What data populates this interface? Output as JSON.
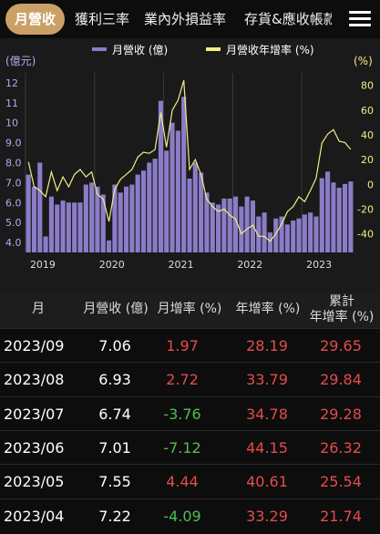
{
  "tabs": [
    {
      "label": "月營收",
      "active": true
    },
    {
      "label": "獲利三率",
      "active": false
    },
    {
      "label": "業內外損益率",
      "active": false
    },
    {
      "label": "存貨&應收帳款",
      "active": false
    }
  ],
  "colors": {
    "accent": "#caa067",
    "bar": "#8b7cc8",
    "line": "#f3ed86",
    "up": "#e54b4b",
    "down": "#4ec04e"
  },
  "chart_data": {
    "type": "bar",
    "legend": [
      "月營收 (億)",
      "月營收年增率 (%)"
    ],
    "legend_position": "top",
    "ylabel_left": "(億元)",
    "ylabel_right": "(%)",
    "ylim_left": [
      3.5,
      12.5
    ],
    "ylim_right": [
      -55,
      90
    ],
    "yticks_left": [
      "12",
      "11",
      "10",
      "9.0",
      "8.0",
      "7.0",
      "6.0",
      "5.0",
      "4.0"
    ],
    "yticks_right": [
      "80",
      "60",
      "40",
      "20",
      "0",
      "-20",
      "-40"
    ],
    "xticks": [
      "2019",
      "2020",
      "2021",
      "2022",
      "2023"
    ],
    "months": [
      "2019/01",
      "2019/02",
      "2019/03",
      "2019/04",
      "2019/05",
      "2019/06",
      "2019/07",
      "2019/08",
      "2019/09",
      "2019/10",
      "2019/11",
      "2019/12",
      "2020/01",
      "2020/02",
      "2020/03",
      "2020/04",
      "2020/05",
      "2020/06",
      "2020/07",
      "2020/08",
      "2020/09",
      "2020/10",
      "2020/11",
      "2020/12",
      "2021/01",
      "2021/02",
      "2021/03",
      "2021/04",
      "2021/05",
      "2021/06",
      "2021/07",
      "2021/08",
      "2021/09",
      "2021/10",
      "2021/11",
      "2021/12",
      "2022/01",
      "2022/02",
      "2022/03",
      "2022/04",
      "2022/05",
      "2022/06",
      "2022/07",
      "2022/08",
      "2022/09",
      "2022/10",
      "2022/11",
      "2022/12",
      "2023/01",
      "2023/02",
      "2023/03",
      "2023/04",
      "2023/05",
      "2023/06",
      "2023/07",
      "2023/08",
      "2023/09"
    ],
    "series": [
      {
        "name": "月營收 (億)",
        "type": "bar",
        "values": [
          7.4,
          6.8,
          8.0,
          4.3,
          6.3,
          5.9,
          6.1,
          6.0,
          6.0,
          6.0,
          6.9,
          7.0,
          6.8,
          6.4,
          4.1,
          6.9,
          6.5,
          6.8,
          6.9,
          7.4,
          7.6,
          8.0,
          8.2,
          11.1,
          8.6,
          10.0,
          9.6,
          11.3,
          7.2,
          8.0,
          7.5,
          6.5,
          6.0,
          5.9,
          6.2,
          6.2,
          6.3,
          5.8,
          6.3,
          6.1,
          5.3,
          5.5,
          4.5,
          5.2,
          5.3,
          4.9,
          5.1,
          5.2,
          5.4,
          5.5,
          5.3,
          7.22,
          7.55,
          7.01,
          6.74,
          6.93,
          7.06
        ]
      },
      {
        "name": "月營收年增率 (%)",
        "type": "line",
        "values": [
          18,
          -2,
          -5,
          -10,
          10,
          -5,
          6,
          -2,
          8,
          12,
          6,
          10,
          -8,
          -12,
          -30,
          -4,
          4,
          8,
          12,
          22,
          26,
          25,
          28,
          58,
          30,
          60,
          68,
          84,
          12,
          20,
          8,
          -12,
          -18,
          -22,
          -20,
          -25,
          -28,
          -40,
          -36,
          -33,
          -42,
          -42,
          -46,
          -40,
          -32,
          -22,
          -18,
          -10,
          -14,
          -5,
          5,
          33.29,
          40.61,
          44.15,
          34.78,
          33.79,
          28.19
        ]
      }
    ]
  },
  "table": {
    "headers": [
      "月",
      "月營收 (億)",
      "月增率 (%)",
      "年增率 (%)",
      "累計\n年增率 (%)"
    ],
    "rows": [
      {
        "month": "2023/09",
        "revenue": "7.06",
        "mom": "1.97",
        "yoy": "28.19",
        "cum": "29.65"
      },
      {
        "month": "2023/08",
        "revenue": "6.93",
        "mom": "2.72",
        "yoy": "33.79",
        "cum": "29.84"
      },
      {
        "month": "2023/07",
        "revenue": "6.74",
        "mom": "-3.76",
        "yoy": "34.78",
        "cum": "29.28"
      },
      {
        "month": "2023/06",
        "revenue": "7.01",
        "mom": "-7.12",
        "yoy": "44.15",
        "cum": "26.32"
      },
      {
        "month": "2023/05",
        "revenue": "7.55",
        "mom": "4.44",
        "yoy": "40.61",
        "cum": "25.54"
      },
      {
        "month": "2023/04",
        "revenue": "7.22",
        "mom": "-4.09",
        "yoy": "33.29",
        "cum": "21.74"
      }
    ]
  }
}
